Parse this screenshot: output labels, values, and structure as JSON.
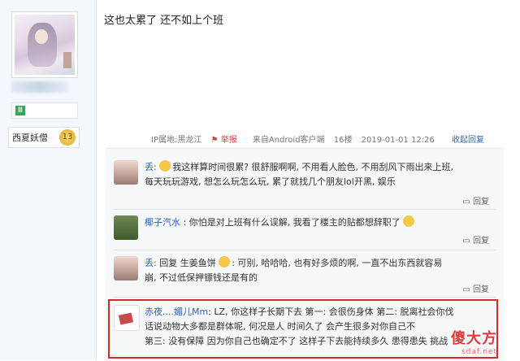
{
  "sidebar": {
    "level_icon": "Ⅲ",
    "badge_text": "西夏妖僧",
    "badge_level": "13"
  },
  "post": {
    "text": "这也太累了 还不如上个班",
    "ip": "IP属地:黑龙江",
    "report": "举报",
    "source": "来自Android客户端",
    "floor": "16楼",
    "datetime": "2019-01-01 12:26",
    "collapse": "收起回复"
  },
  "replies": [
    {
      "user": "丢:",
      "text_line1": "我这样算时间很累? 很舒服啊啊, 不用看人脸色, 不用刮风下雨出来上班,",
      "text_line2": "每天玩玩游戏, 想怎么玩怎么玩, 累了就找几个朋友lol开黑, 娱乐",
      "reply": "回复"
    },
    {
      "user": "椰子汽水",
      "text_line1": ": 你怕是对上班有什么误解, 我看了楼主的贴都想辞职了",
      "reply": "回复"
    },
    {
      "user": "丢:",
      "text_line1": "回复 生姜鱼饼",
      "text_line1b": ": 可别, 哈哈哈, 也有好多烦的啊, 一直不出东西就容易",
      "text_line2": "崩, 不过低保押镖钱还是有的",
      "reply": "回复"
    },
    {
      "user": "赤夜....媚儿Mm",
      "text_line1": ": LZ, 你这样子长期下去 第一: 会很伤身体 第二: 脱离社会你伐",
      "text_line2": "话说动物大多都是群体呢, 何况是人 时间久了 会产生很多对你自己不",
      "text_line3": "第三: 没有保障 因为你自己也确定不了 这样子下去能持续多久 患得患失 挑战"
    }
  ],
  "watermark": {
    "main": "傻大方",
    "sub": "sdaf.net"
  },
  "colors": {
    "link": "#2d64b3",
    "highlight_border": "#d22b2b"
  }
}
